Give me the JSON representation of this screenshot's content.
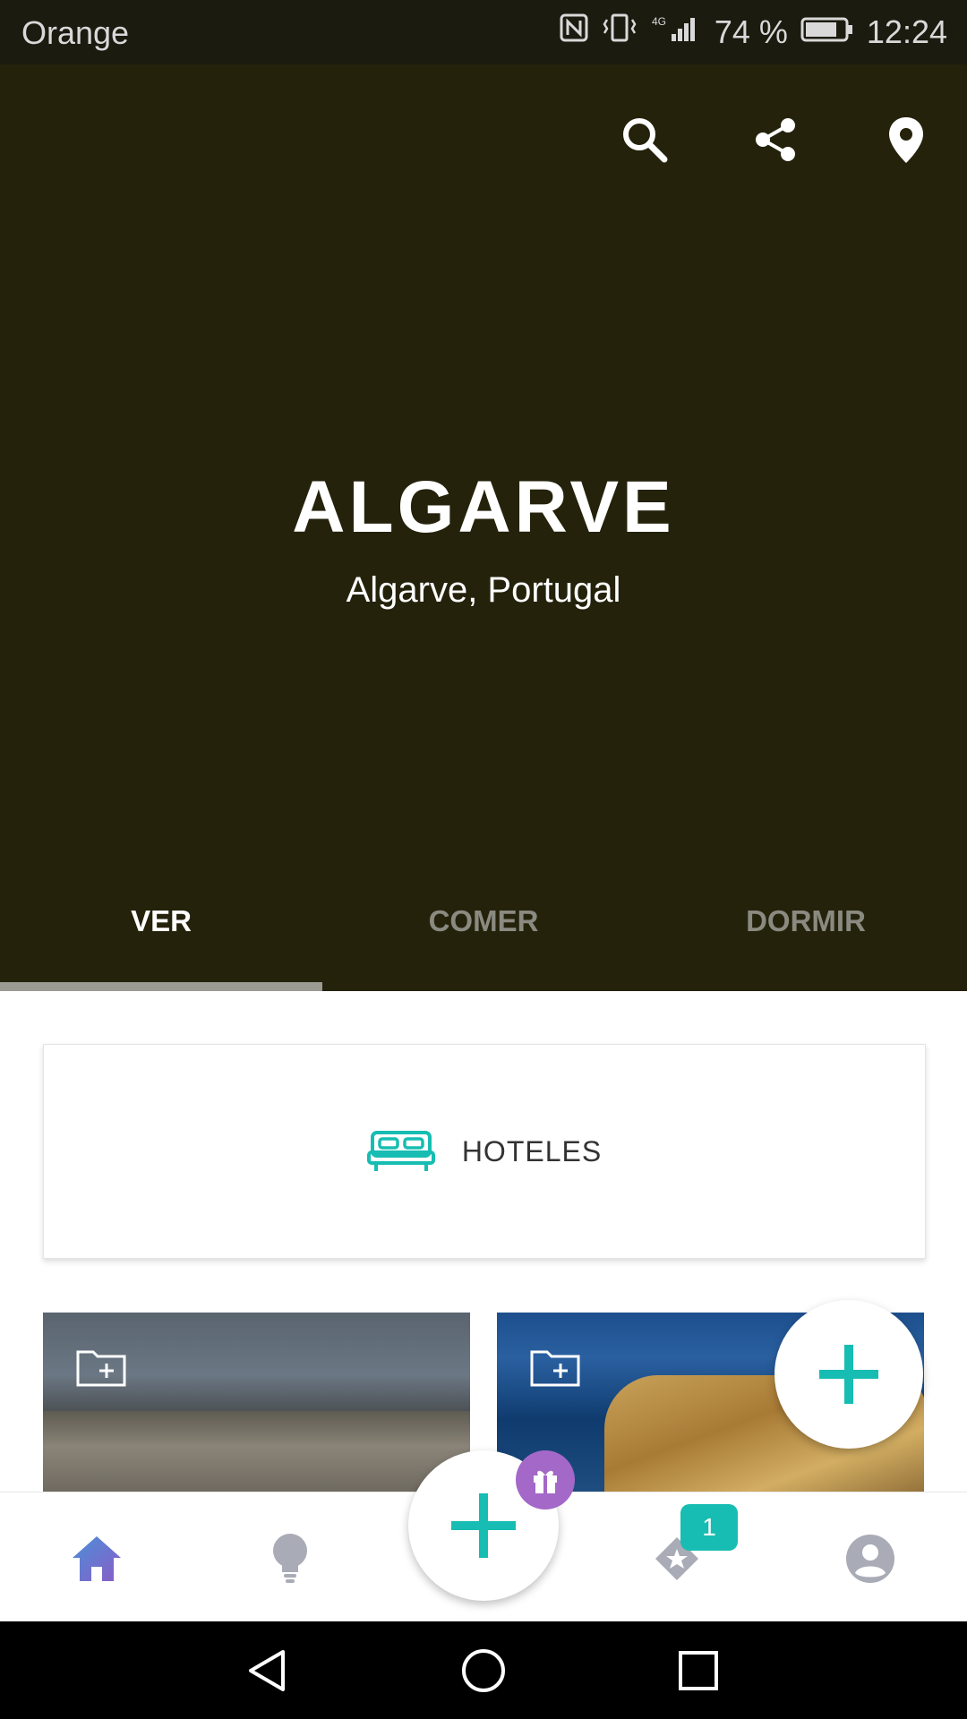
{
  "status_bar": {
    "carrier": "Orange",
    "battery": "74 %",
    "time": "12:24",
    "network": "4G"
  },
  "hero": {
    "title": "ALGARVE",
    "subtitle": "Algarve, Portugal",
    "background_color": "#24220b",
    "actions": [
      "search-icon",
      "share-icon",
      "location-pin-icon"
    ]
  },
  "tabs": {
    "items": [
      {
        "label": "VER",
        "active": true
      },
      {
        "label": "COMER",
        "active": false
      },
      {
        "label": "DORMIR",
        "active": false
      }
    ]
  },
  "hotel_card": {
    "icon": "bed-icon",
    "label": "HOTELES"
  },
  "photo_cards": [
    {
      "icon": "folder-add-icon"
    },
    {
      "icon": "folder-add-icon"
    }
  ],
  "fab": {
    "icon": "plus-icon",
    "color": "#17bdb2"
  },
  "bottom_nav": {
    "items": [
      "home-icon",
      "lightbulb-icon",
      "plus-icon",
      "star-tag-icon",
      "profile-icon"
    ],
    "gift_badge_icon": "gift-icon",
    "favorites_count": "1",
    "accent_color": "#17bdb2"
  },
  "system_nav": {
    "buttons": [
      "back-icon",
      "home-circle-icon",
      "recents-icon"
    ]
  }
}
